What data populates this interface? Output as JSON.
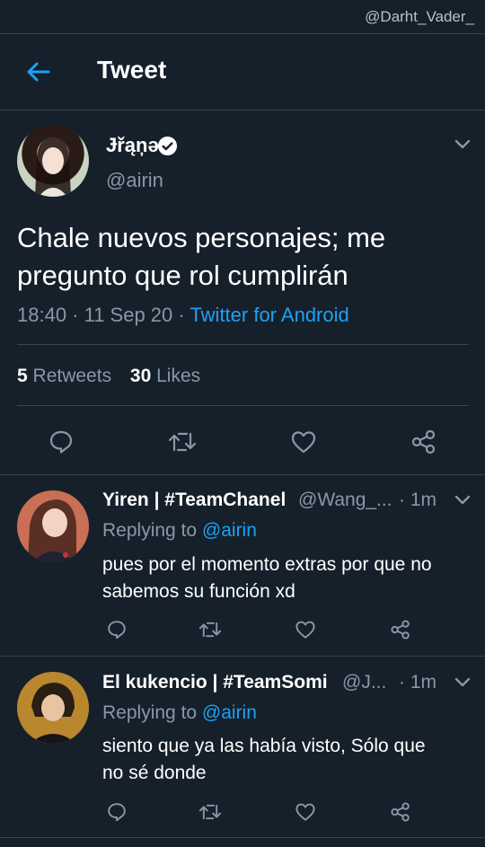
{
  "watermark": "@Darht_Vader_",
  "header": {
    "title": "Tweet"
  },
  "tweet": {
    "display_name": "Ɉřąņə",
    "handle": "@airin",
    "text_line1": "Chale nuevos personajes; me",
    "text_line2": "pregunto que rol cumplirán",
    "time_date": "18:40 · 11 Sep 20 · ",
    "client": "Twitter for Android",
    "retweets_count": "5",
    "retweets_label": "Retweets",
    "likes_count": "30",
    "likes_label": "Likes"
  },
  "replies": [
    {
      "name": "Yiren | #TeamChanel",
      "handle": "@Wang_...",
      "time": "· 1m",
      "replying_prefix": "Replying to ",
      "replying_to": "@airin",
      "text_line1": "pues por el momento extras por que no",
      "text_line2": "sabemos su función xd"
    },
    {
      "name": "El kukencio | #TeamSomi",
      "handle": "@J...",
      "time": "· 1m",
      "replying_prefix": "Replying to ",
      "replying_to": "@airin",
      "text_line1": "siento que ya las había visto, Sólo que",
      "text_line2": "no sé donde"
    }
  ],
  "icons": {
    "back": "arrow-left-icon",
    "verified": "verified-badge-icon",
    "reply": "comment-icon",
    "retweet": "retweet-icon",
    "like": "heart-icon",
    "share": "share-icon",
    "more": "chevron-down-icon"
  },
  "colors": {
    "background": "#15202b",
    "accent": "#1da1f2",
    "secondary_text": "#8899a6",
    "divider": "#38444d"
  }
}
